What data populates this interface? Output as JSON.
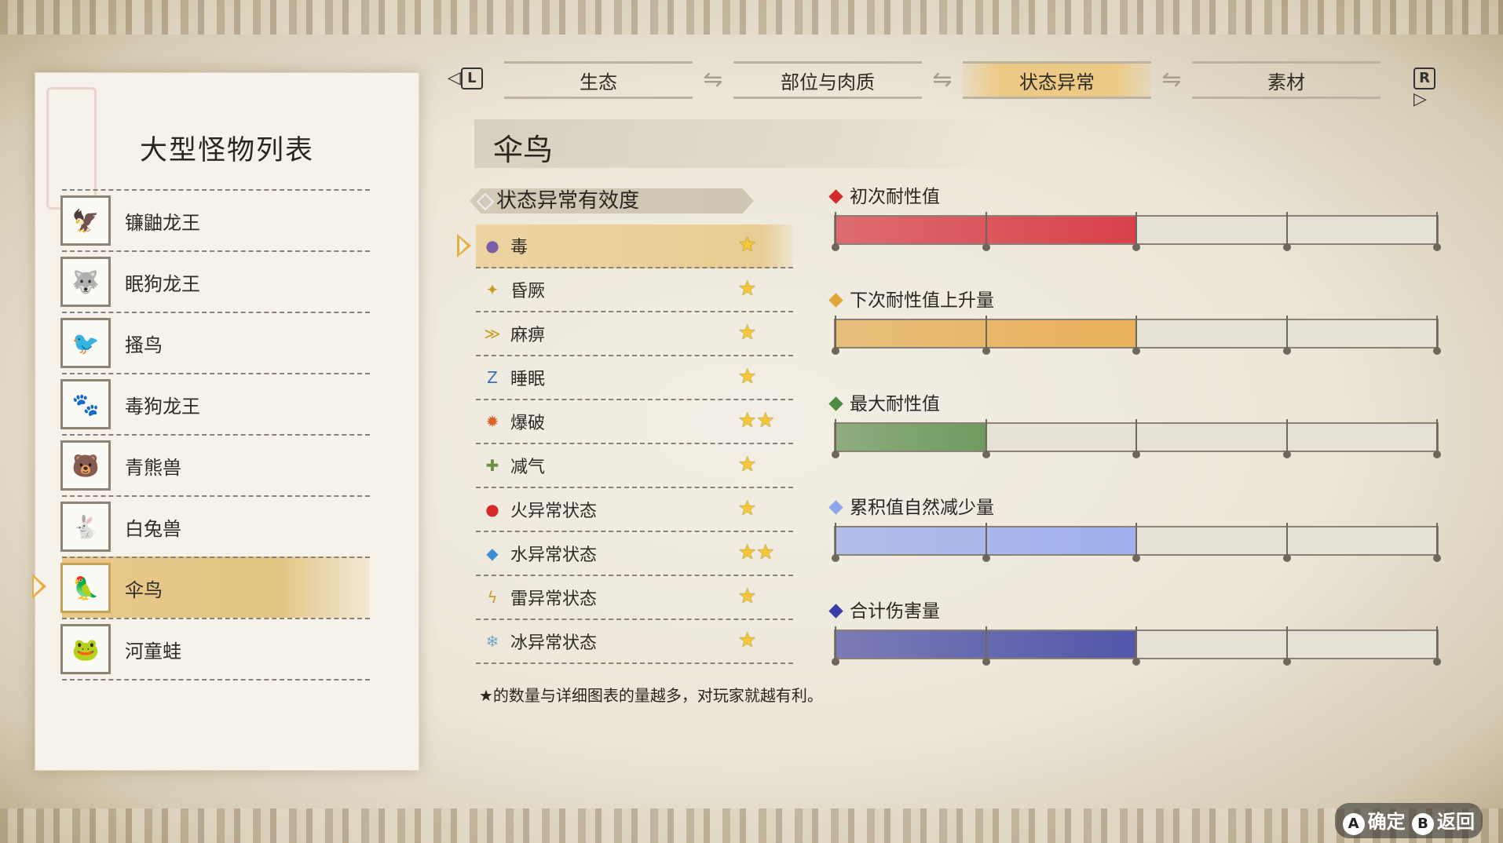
{
  "left_panel": {
    "title": "大型怪物列表",
    "monsters": [
      {
        "name": "镰鼬龙王",
        "icon": "kamaitachi-icon",
        "selected": false
      },
      {
        "name": "眠狗龙王",
        "icon": "sleep-dog-icon",
        "selected": false
      },
      {
        "name": "搔鸟",
        "icon": "bird-icon",
        "selected": false
      },
      {
        "name": "毒狗龙王",
        "icon": "poison-dog-icon",
        "selected": false
      },
      {
        "name": "青熊兽",
        "icon": "bear-icon",
        "selected": false
      },
      {
        "name": "白兔兽",
        "icon": "rabbit-icon",
        "selected": false
      },
      {
        "name": "伞鸟",
        "icon": "umbrella-bird-icon",
        "selected": true
      },
      {
        "name": "河童蛙",
        "icon": "frog-icon",
        "selected": false
      }
    ]
  },
  "tabs": {
    "left_key": "L",
    "right_key": "R",
    "items": [
      {
        "label": "生态",
        "active": false
      },
      {
        "label": "部位与肉质",
        "active": false
      },
      {
        "label": "状态异常",
        "active": true
      },
      {
        "label": "素材",
        "active": false
      }
    ]
  },
  "monster_name": "伞鸟",
  "effectiveness": {
    "header": "状态异常有效度",
    "rows": [
      {
        "name": "毒",
        "icon": "poison-icon",
        "stars": 1,
        "selected": true
      },
      {
        "name": "昏厥",
        "icon": "stun-icon",
        "stars": 1,
        "selected": false
      },
      {
        "name": "麻痹",
        "icon": "paralysis-icon",
        "stars": 1,
        "selected": false
      },
      {
        "name": "睡眠",
        "icon": "sleep-icon",
        "stars": 1,
        "selected": false
      },
      {
        "name": "爆破",
        "icon": "blast-icon",
        "stars": 2,
        "selected": false
      },
      {
        "name": "减气",
        "icon": "exhaust-icon",
        "stars": 1,
        "selected": false
      },
      {
        "name": "火异常状态",
        "icon": "fire-icon",
        "stars": 1,
        "selected": false
      },
      {
        "name": "水异常状态",
        "icon": "water-icon",
        "stars": 2,
        "selected": false
      },
      {
        "name": "雷异常状态",
        "icon": "thunder-icon",
        "stars": 1,
        "selected": false
      },
      {
        "name": "冰异常状态",
        "icon": "ice-icon",
        "stars": 1,
        "selected": false
      }
    ],
    "footnote": "★的数量与详细图表的量越多，对玩家就越有利。"
  },
  "gauges": [
    {
      "label": "初次耐性值",
      "color": "#d9414a",
      "diamond": "#d42a2a",
      "fill_fraction": 0.5
    },
    {
      "label": "下次耐性值上升量",
      "color": "#e9b15a",
      "diamond": "#e2a53a",
      "fill_fraction": 0.5
    },
    {
      "label": "最大耐性值",
      "color": "#6e9a5f",
      "diamond": "#4f8a45",
      "fill_fraction": 0.25
    },
    {
      "label": "累积值自然减少量",
      "color": "#9fb0ee",
      "diamond": "#8fa6ea",
      "fill_fraction": 0.5
    },
    {
      "label": "合计伤害量",
      "color": "#5356a9",
      "diamond": "#3a3ca8",
      "fill_fraction": 0.5
    }
  ],
  "controls": {
    "a_label": "确定",
    "b_label": "返回",
    "a_key": "A",
    "b_key": "B"
  }
}
